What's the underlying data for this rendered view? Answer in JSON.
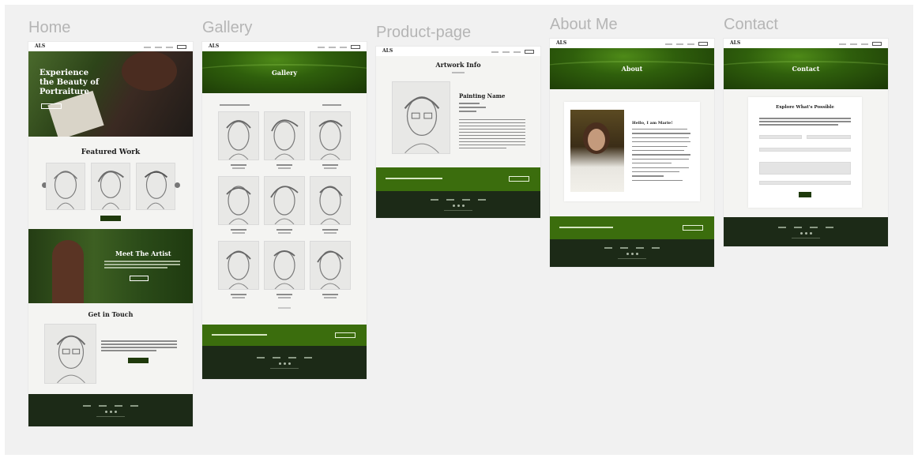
{
  "frames": {
    "home": {
      "label": "Home",
      "logo": "ALS",
      "hero_title": "Experience the Beauty of Portraiture",
      "featured_title": "Featured Work",
      "meet_title": "Meet The Artist",
      "contact_title": "Get in Touch"
    },
    "gallery": {
      "label": "Gallery",
      "logo": "ALS",
      "banner_title": "Gallery"
    },
    "product": {
      "label": "Product-page",
      "logo": "ALS",
      "page_title": "Artwork Info",
      "painting_name": "Painting Name"
    },
    "about": {
      "label": "About Me",
      "logo": "ALS",
      "banner_title": "About",
      "greeting": "Hello, I am Marie!"
    },
    "contact": {
      "label": "Contact",
      "logo": "ALS",
      "banner_title": "Contact",
      "form_title": "Explore What's Possible"
    }
  },
  "colors": {
    "canvas": "#f1f1f1",
    "label": "#b5b5b5",
    "dark_green": "#1c2a17",
    "cta_green": "#3b6d0d",
    "banner_green": "#2f5f0c"
  }
}
